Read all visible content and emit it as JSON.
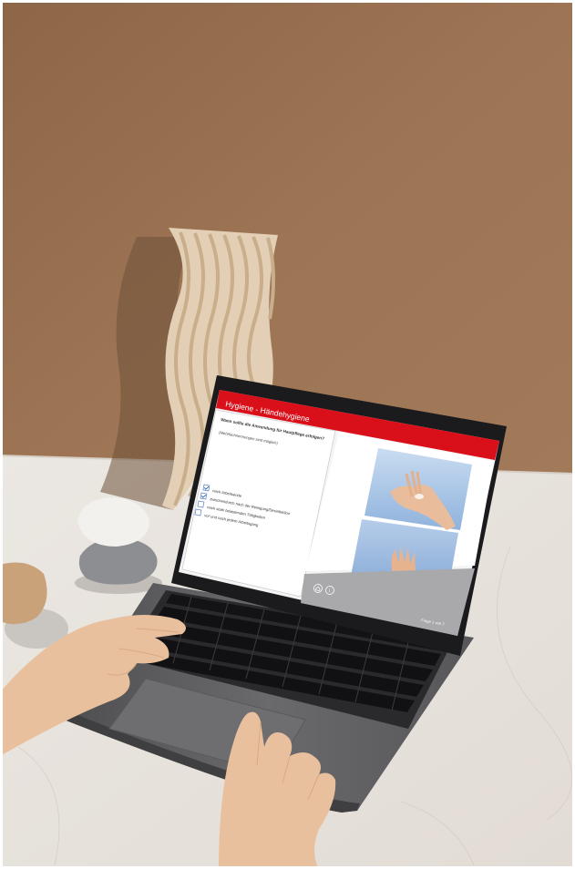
{
  "screen": {
    "header_title": "Hygiene - Händehygiene",
    "question": "Wann sollte die Anwendung für Hautpflege erfolgen?",
    "hint": "(Mehrfachnennungen sind möglich)",
    "options": [
      {
        "label": "nach Arbeitsende",
        "checked": true
      },
      {
        "label": "zwischendurch nach der Reinigung/Desinfektion",
        "checked": true
      },
      {
        "label": "nach stark belastenden Tätigkeiten",
        "checked": false
      },
      {
        "label": "vor und nach jedem Arbeitsgang",
        "checked": false
      }
    ],
    "page_indicator": "Frage 1 von 7",
    "nav_icons": [
      "home-icon",
      "info-icon"
    ]
  },
  "colors": {
    "wall": "#9b7353",
    "table": "#e9e4df",
    "header_red": "#d9101a",
    "laptop_body": "#5f5e60",
    "keys": "#1c1c1e",
    "skin": "#e8bf9c",
    "hand_photo_bg": "#9fbde0"
  }
}
